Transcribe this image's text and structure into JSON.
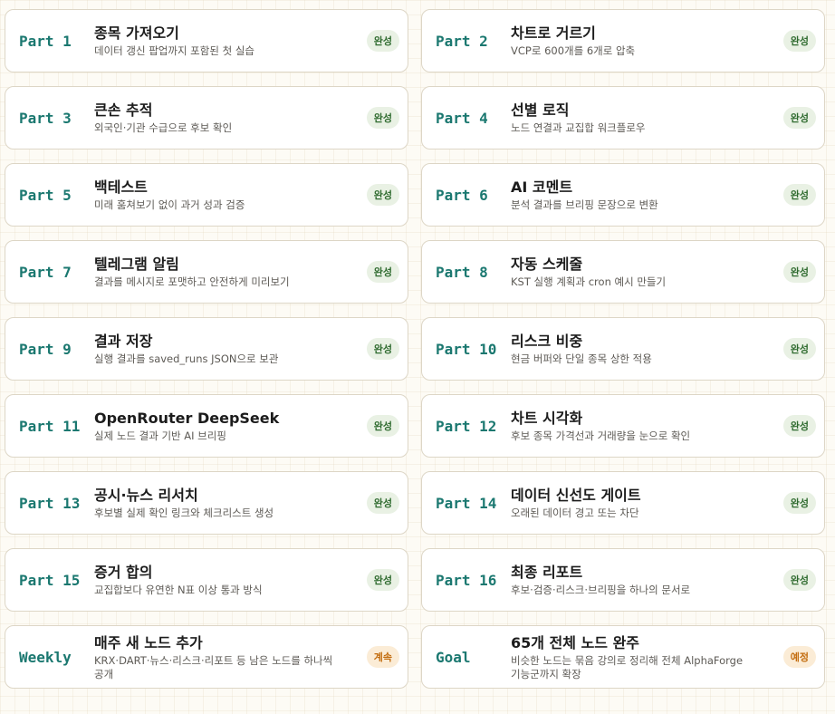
{
  "cards": [
    {
      "part": "Part 1",
      "title": "종목 가져오기",
      "desc": "데이터 갱신 팝업까지 포함된 첫 실습",
      "badge": "완성",
      "status": "done"
    },
    {
      "part": "Part 2",
      "title": "차트로 거르기",
      "desc": "VCP로 600개를 6개로 압축",
      "badge": "완성",
      "status": "done"
    },
    {
      "part": "Part 3",
      "title": "큰손 추적",
      "desc": "외국인·기관 수급으로 후보 확인",
      "badge": "완성",
      "status": "done"
    },
    {
      "part": "Part 4",
      "title": "선별 로직",
      "desc": "노드 연결과 교집합 워크플로우",
      "badge": "완성",
      "status": "done"
    },
    {
      "part": "Part 5",
      "title": "백테스트",
      "desc": "미래 훔쳐보기 없이 과거 성과 검증",
      "badge": "완성",
      "status": "done"
    },
    {
      "part": "Part 6",
      "title": "AI 코멘트",
      "desc": "분석 결과를 브리핑 문장으로 변환",
      "badge": "완성",
      "status": "done"
    },
    {
      "part": "Part 7",
      "title": "텔레그램 알림",
      "desc": "결과를 메시지로 포맷하고 안전하게 미리보기",
      "badge": "완성",
      "status": "done"
    },
    {
      "part": "Part 8",
      "title": "자동 스케줄",
      "desc": "KST 실행 계획과 cron 예시 만들기",
      "badge": "완성",
      "status": "done"
    },
    {
      "part": "Part 9",
      "title": "결과 저장",
      "desc": "실행 결과를 saved_runs JSON으로 보관",
      "badge": "완성",
      "status": "done"
    },
    {
      "part": "Part 10",
      "title": "리스크 비중",
      "desc": "현금 버퍼와 단일 종목 상한 적용",
      "badge": "완성",
      "status": "done"
    },
    {
      "part": "Part 11",
      "title": "OpenRouter DeepSeek",
      "desc": "실제 노드 결과 기반 AI 브리핑",
      "badge": "완성",
      "status": "done"
    },
    {
      "part": "Part 12",
      "title": "차트 시각화",
      "desc": "후보 종목 가격선과 거래량을 눈으로 확인",
      "badge": "완성",
      "status": "done"
    },
    {
      "part": "Part 13",
      "title": "공시·뉴스 리서치",
      "desc": "후보별 실제 확인 링크와 체크리스트 생성",
      "badge": "완성",
      "status": "done"
    },
    {
      "part": "Part 14",
      "title": "데이터 신선도 게이트",
      "desc": "오래된 데이터 경고 또는 차단",
      "badge": "완성",
      "status": "done"
    },
    {
      "part": "Part 15",
      "title": "증거 합의",
      "desc": "교집합보다 유연한 N표 이상 통과 방식",
      "badge": "완성",
      "status": "done"
    },
    {
      "part": "Part 16",
      "title": "최종 리포트",
      "desc": "후보·검증·리스크·브리핑을 하나의 문서로",
      "badge": "완성",
      "status": "done"
    },
    {
      "part": "Weekly",
      "title": "매주 새 노드 추가",
      "desc": "KRX·DART·뉴스·리스크·리포트 등 남은 노드를 하나씩 공개",
      "badge": "계속",
      "status": "ongoing"
    },
    {
      "part": "Goal",
      "title": "65개 전체 노드 완주",
      "desc": "비슷한 노드는 묶음 강의로 정리해 전체 AlphaForge 기능군까지 확장",
      "badge": "예정",
      "status": "ongoing"
    }
  ],
  "colors": {
    "accent": "#1b7870",
    "done_badge_bg": "#e9f1e4",
    "done_badge_text": "#2f6b2f",
    "ongoing_badge_bg": "#fbecd6",
    "ongoing_badge_text": "#c36d10",
    "page_bg": "#fdfbf5"
  }
}
